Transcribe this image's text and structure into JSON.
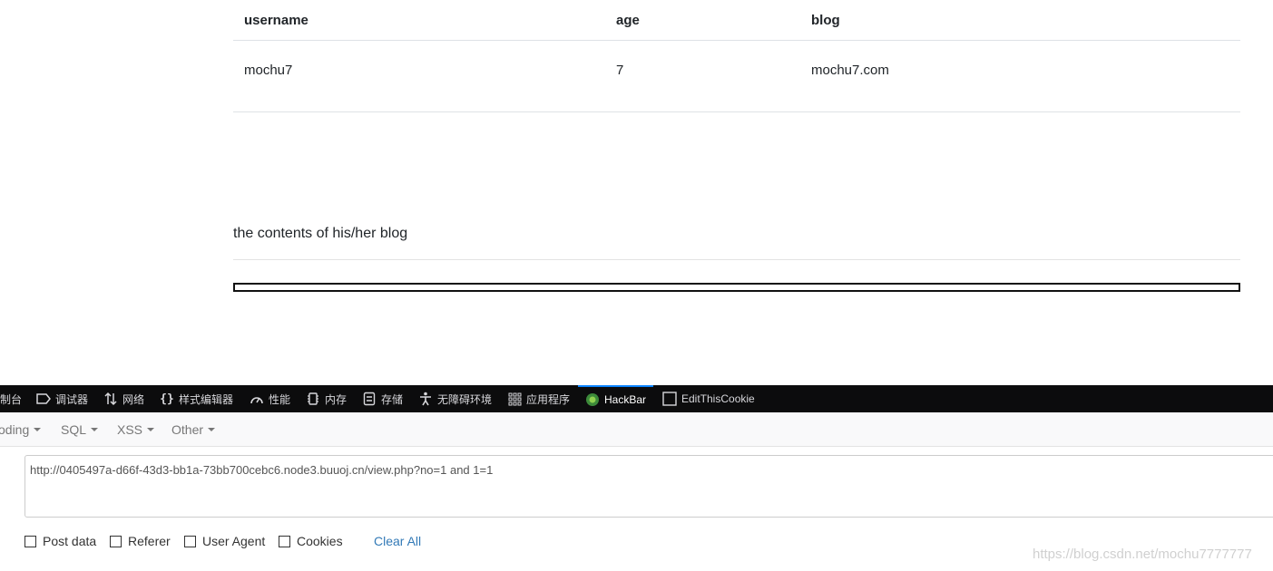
{
  "table": {
    "headers": [
      "username",
      "age",
      "blog"
    ],
    "rows": [
      [
        "mochu7",
        "7",
        "mochu7.com"
      ]
    ]
  },
  "blog_caption": "the contents of his/her blog",
  "devtools": {
    "tabs": [
      {
        "label": "制台",
        "icon": "console-icon"
      },
      {
        "label": "调试器",
        "icon": "debugger-icon"
      },
      {
        "label": "网络",
        "icon": "network-icon"
      },
      {
        "label": "样式编辑器",
        "icon": "braces-icon"
      },
      {
        "label": "性能",
        "icon": "performance-icon"
      },
      {
        "label": "内存",
        "icon": "memory-icon"
      },
      {
        "label": "存储",
        "icon": "storage-icon"
      },
      {
        "label": "无障碍环境",
        "icon": "accessibility-icon"
      },
      {
        "label": "应用程序",
        "icon": "application-icon"
      },
      {
        "label": "HackBar",
        "icon": "hackbar-icon"
      },
      {
        "label": "EditThisCookie",
        "icon": "cookie-box-icon"
      }
    ],
    "active_tab": "HackBar",
    "accent_color": "#0a84ff"
  },
  "hackbar": {
    "menu": [
      "oding",
      "SQL",
      "XSS",
      "Other"
    ],
    "url": "http://0405497a-d66f-43d3-bb1a-73bb700cebc6.node3.buuoj.cn/view.php?no=1 and 1=1",
    "options": [
      "Post data",
      "Referer",
      "User Agent",
      "Cookies"
    ],
    "clear_label": "Clear All"
  },
  "watermark": "https://blog.csdn.net/mochu7777777"
}
